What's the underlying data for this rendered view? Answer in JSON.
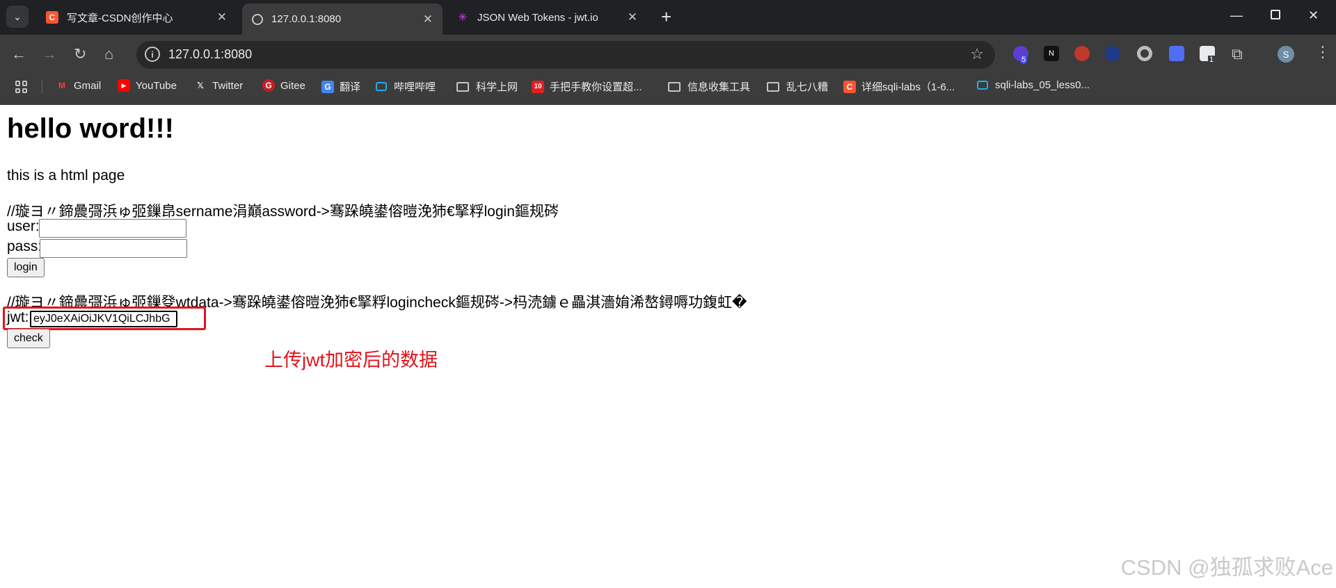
{
  "tabs": [
    {
      "title": "写文章-CSDN创作中心",
      "favicon": "C",
      "favicon_color": "#fc5531"
    },
    {
      "title": "127.0.0.1:8080",
      "favicon": "globe-icon",
      "active": true
    },
    {
      "title": "JSON Web Tokens - jwt.io",
      "favicon": "jwt-icon"
    }
  ],
  "address": {
    "url": "127.0.0.1:8080"
  },
  "extensions": {
    "badge_1": "5",
    "badge_2": "1",
    "avatar": "S"
  },
  "bookmarks": [
    {
      "label": "Gmail",
      "icon": "gmail-icon"
    },
    {
      "label": "YouTube",
      "icon": "youtube-icon"
    },
    {
      "label": "Twitter",
      "icon": "x-icon"
    },
    {
      "label": "Gitee",
      "icon": "gitee-icon"
    },
    {
      "label": "翻译",
      "icon": "translate-icon"
    },
    {
      "label": "哔哩哔哩",
      "icon": "bilibili-icon"
    },
    {
      "label": "科学上网",
      "icon": "folder-icon"
    },
    {
      "label": "手把手教你设置超...",
      "icon": "page-icon"
    },
    {
      "label": "信息收集工具",
      "icon": "folder-icon"
    },
    {
      "label": "乱七八糟",
      "icon": "folder-icon"
    },
    {
      "label": "详细sqli-labs（1-6...",
      "icon": "csdn-icon"
    },
    {
      "label": "sqli-labs_05_less0...",
      "icon": "bilibili-icon"
    }
  ],
  "page": {
    "heading": "hello word!!!",
    "intro": "this is a html page",
    "comment1": "//璇ヨ〃鍗曟彁浜ゅ弬鏁皍sername涓巔assword->骞跺皢鍙傛暟浼犻€掔粰login鏂规硶",
    "user_label": "user:",
    "user_value": "",
    "pass_label": "pass:",
    "pass_value": "",
    "login_button": "login",
    "comment2": "//璇ヨ〃鍗曟彁浜ゅ弬鏁癹wtdata->骞跺皢鍙傛暟浼犻€掔粰logincheck鏂规硶->杩涜鐪ｅ畾淇濇姢浠嶅鐞嗕功鍑虹�",
    "jwt_label": "jwt:",
    "jwt_value": "eyJ0eXAiOiJKV1QiLCJhbG",
    "check_button": "check"
  },
  "annotation": "上传jwt加密后的数据",
  "watermark": "CSDN @独孤求败Ace",
  "colors": {
    "accent_red": "#e3121a",
    "chrome_dark": "#202124",
    "toolbar": "#3c3c3c"
  }
}
